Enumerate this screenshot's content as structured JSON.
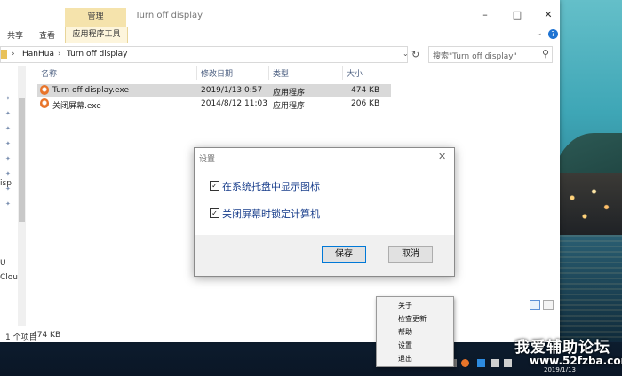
{
  "window": {
    "title": "Turn off display",
    "context_tab": "管理",
    "ribbon_tabs": [
      "共享",
      "查看",
      "应用程序工具"
    ],
    "help": "?"
  },
  "address": {
    "crumbs": [
      "HanHua",
      "Turn off display"
    ],
    "search_placeholder": "搜索\"Turn off display\""
  },
  "columns": [
    "名称",
    "修改日期",
    "类型",
    "大小"
  ],
  "files": [
    {
      "name": "Turn off display.exe",
      "date": "2019/1/13 0:57",
      "type": "应用程序",
      "size": "474 KB",
      "selected": true
    },
    {
      "name": "关闭屏幕.exe",
      "date": "2014/8/12 11:03",
      "type": "应用程序",
      "size": "206 KB",
      "selected": false
    }
  ],
  "nav": {
    "partial_labels": [
      "isp",
      "U",
      "Clou"
    ]
  },
  "status": {
    "count": "1 个项目",
    "size": "474 KB"
  },
  "dialog": {
    "title": "设置",
    "options": [
      {
        "label": "在系统托盘中显示图标",
        "checked": true
      },
      {
        "label": "关闭屏幕时锁定计算机",
        "checked": true
      }
    ],
    "save": "保存",
    "cancel": "取消"
  },
  "tray_menu": [
    "关于",
    "检查更新",
    "帮助",
    "设置",
    "退出"
  ],
  "taskbar": {
    "date": "2019/1/13"
  },
  "watermark": {
    "line1": "我爱辅助论坛",
    "line2": "www.52fzba.com"
  },
  "colors": {
    "accent": "#0078d7",
    "context_tab": "#f5e3ac",
    "selection": "#d9d9d9"
  }
}
